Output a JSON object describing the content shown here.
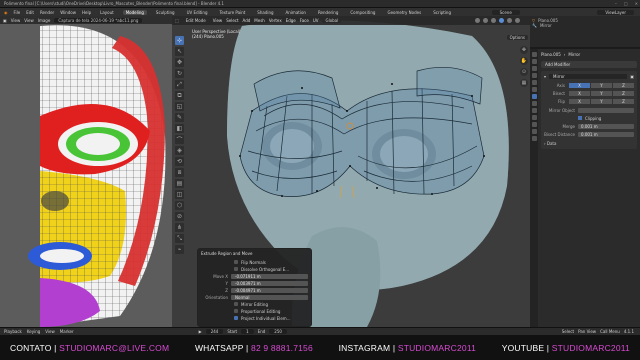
{
  "window": {
    "title": "Polimento final [C:\\Users\\studi\\OneDrive\\Desktop\\Livro_Mascotes_Blender\\Polimento final.blend] - Blender 4.1",
    "controls": [
      "–",
      "□",
      "✕"
    ]
  },
  "menubar": {
    "menus": [
      "File",
      "Edit",
      "Render",
      "Window",
      "Help"
    ],
    "workspaces": [
      "Layout",
      "Modeling",
      "Sculpting",
      "UV Editing",
      "Texture Paint",
      "Shading",
      "Animation",
      "Rendering",
      "Compositing",
      "Geometry Nodes",
      "Scripting"
    ],
    "active_workspace": "Modeling",
    "scene": "Scene",
    "view_layer": "ViewLayer"
  },
  "image_editor": {
    "header": [
      "View",
      "View",
      "Image"
    ],
    "image_name": "Captura de tela 2024-06-19 *abc11.png",
    "colors": {
      "skin": "#f3f3f3",
      "red": "#e0201e",
      "yellow": "#f0d21a",
      "green": "#49c436",
      "blue": "#2d5ad6",
      "magenta": "#b23fd0"
    }
  },
  "viewport": {
    "mode": "Edit Mode",
    "menus": [
      "View",
      "Select",
      "Add",
      "Mesh",
      "Vertex",
      "Edge",
      "Face",
      "UV"
    ],
    "orientation": "Global",
    "options_label": "Options",
    "info_line1": "User Perspective (Local)",
    "info_line2": "(244) Plano.005",
    "tools": [
      "⊹",
      "↖",
      "✥",
      "↻",
      "⤢",
      "⧉",
      "◱",
      "✎",
      "◧",
      "⌒",
      "◈",
      "⟲",
      "⧈",
      "▤",
      "◫",
      "⬡",
      "⊘",
      "⋔",
      "⤡",
      "⌁"
    ],
    "gizmo": [
      "✥",
      "✋",
      "⊙",
      "▦"
    ]
  },
  "operator": {
    "title": "Extrude Region and Move",
    "flip_normals": "Flip Normals",
    "dissolve": "Dissolve Orthogonal E...",
    "move_label": "Move X",
    "move_x": "-0.071911 m",
    "y_label": "Y",
    "move_y": "-0.003971 m",
    "z_label": "Z",
    "move_z": "-0.004971 m",
    "orientation_label": "Orientation",
    "orientation": "Normal",
    "mirror_editing": "Mirror Editing",
    "proportional": "Proportional Editing",
    "project_individual": "Project Individual Elem..."
  },
  "outliner": {
    "rows": [
      "Plano.005",
      "Mirror"
    ]
  },
  "properties": {
    "object_name": "Plano.005",
    "modifier_tab": "Mirror",
    "add_modifier": "Add Modifier",
    "modifier_name": "Mirror",
    "axis_label": "Axis",
    "bisect_label": "Bisect",
    "flip_label": "Flip",
    "axes": [
      "X",
      "Y",
      "Z"
    ],
    "mirror_object_label": "Mirror Object",
    "clipping": "Clipping",
    "merge_label": "Merge",
    "merge_value": "0.001 m",
    "bisect_distance_label": "Bisect Distance",
    "bisect_distance_value": "0.001 m",
    "data_panel": "› Data"
  },
  "timeline": {
    "items": [
      "Playback",
      "Keying",
      "View",
      "Marker"
    ],
    "current": "244",
    "start_label": "Start",
    "start": "1",
    "end_label": "End",
    "end": "250",
    "status_left": "Select",
    "status_mid": "Pan View",
    "status_right": "Call Menu",
    "version": "4.1.1"
  },
  "footer": {
    "contact_label": "CONTATO | ",
    "contact_value": "STUDIOMARC@LIVE.COM",
    "whatsapp_label": "WHATSAPP | ",
    "whatsapp_value": "82 9 8881.7156",
    "instagram_label": "INSTAGRAM | ",
    "instagram_value": "STUDIOMARC2011",
    "youtube_label": "YOUTUBE | ",
    "youtube_value": "STUDIOMARC2011"
  }
}
